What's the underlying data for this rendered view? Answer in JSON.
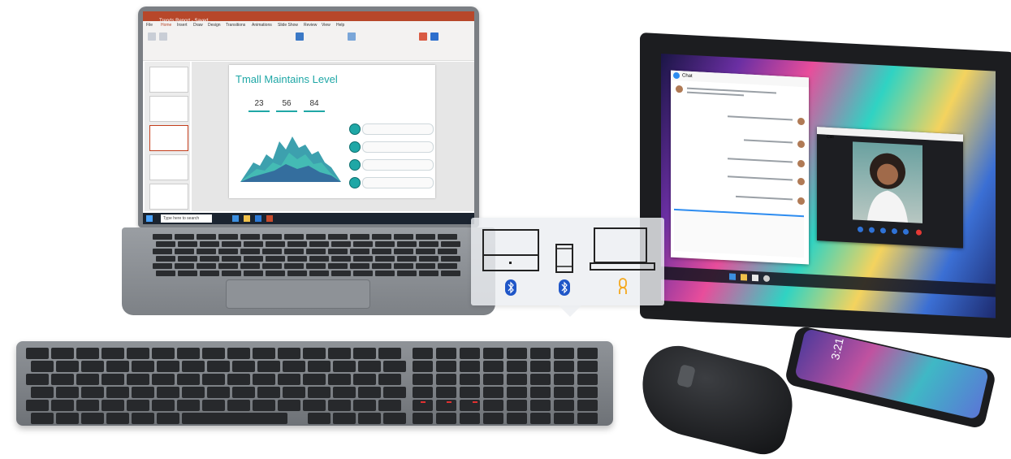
{
  "laptop": {
    "app": "PowerPoint",
    "titlebar": "Trends Report - Saved",
    "ribbon_tabs": [
      "File",
      "Home",
      "Insert",
      "Draw",
      "Design",
      "Transitions",
      "Animations",
      "Slide Show",
      "Review",
      "View",
      "Help"
    ],
    "slide": {
      "title": "Tmall Maintains Level",
      "stats": [
        "23",
        "56",
        "84"
      ]
    },
    "taskbar_search": "Type here to search"
  },
  "tablet": {
    "chat_app": "Chat",
    "call_app": "Call"
  },
  "pairing": {
    "devices": [
      {
        "icon": "monitor-icon",
        "status_icon": "bluetooth-icon",
        "status_color": "#1f56c8"
      },
      {
        "icon": "phone-icon",
        "status_icon": "bluetooth-icon",
        "status_color": "#1f56c8"
      },
      {
        "icon": "laptop-icon",
        "status_icon": "link-icon",
        "status_color": "#f4a81d"
      }
    ]
  },
  "phone": {
    "clock": "3:21"
  }
}
